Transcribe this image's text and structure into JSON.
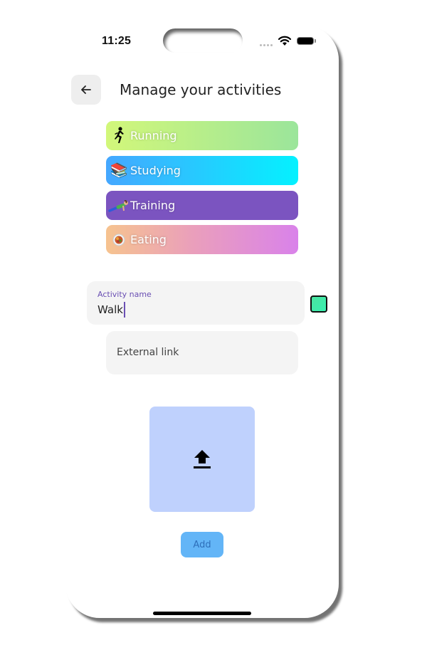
{
  "status_bar": {
    "time": "11:25",
    "icons": [
      "signal-dots-icon",
      "wifi-icon",
      "battery-icon"
    ]
  },
  "header": {
    "back_icon": "arrow-left-icon",
    "title": "Manage your activities"
  },
  "activities": [
    {
      "label": "Running",
      "icon": "runner-icon",
      "emoji": "🏃",
      "colors": [
        "#d2f77a",
        "#9be59b"
      ]
    },
    {
      "label": "Studying",
      "icon": "books-icon",
      "emoji": "📚",
      "colors": [
        "#45a7ff",
        "#04f1ff"
      ]
    },
    {
      "label": "Training",
      "icon": "push-up-icon",
      "emoji": "🤸",
      "colors": [
        "#7b54c0",
        "#7b54c0"
      ]
    },
    {
      "label": "Eating",
      "icon": "food-plate-icon",
      "emoji": "🍲",
      "colors": [
        "#f6c38f",
        "#d982ea"
      ]
    }
  ],
  "form": {
    "activity_name": {
      "label": "Activity name",
      "value": "Walk"
    },
    "color_swatch": "#3ee8a8",
    "external_link": {
      "placeholder": "External link",
      "value": ""
    },
    "upload_icon": "upload-icon",
    "add_label": "Add"
  }
}
